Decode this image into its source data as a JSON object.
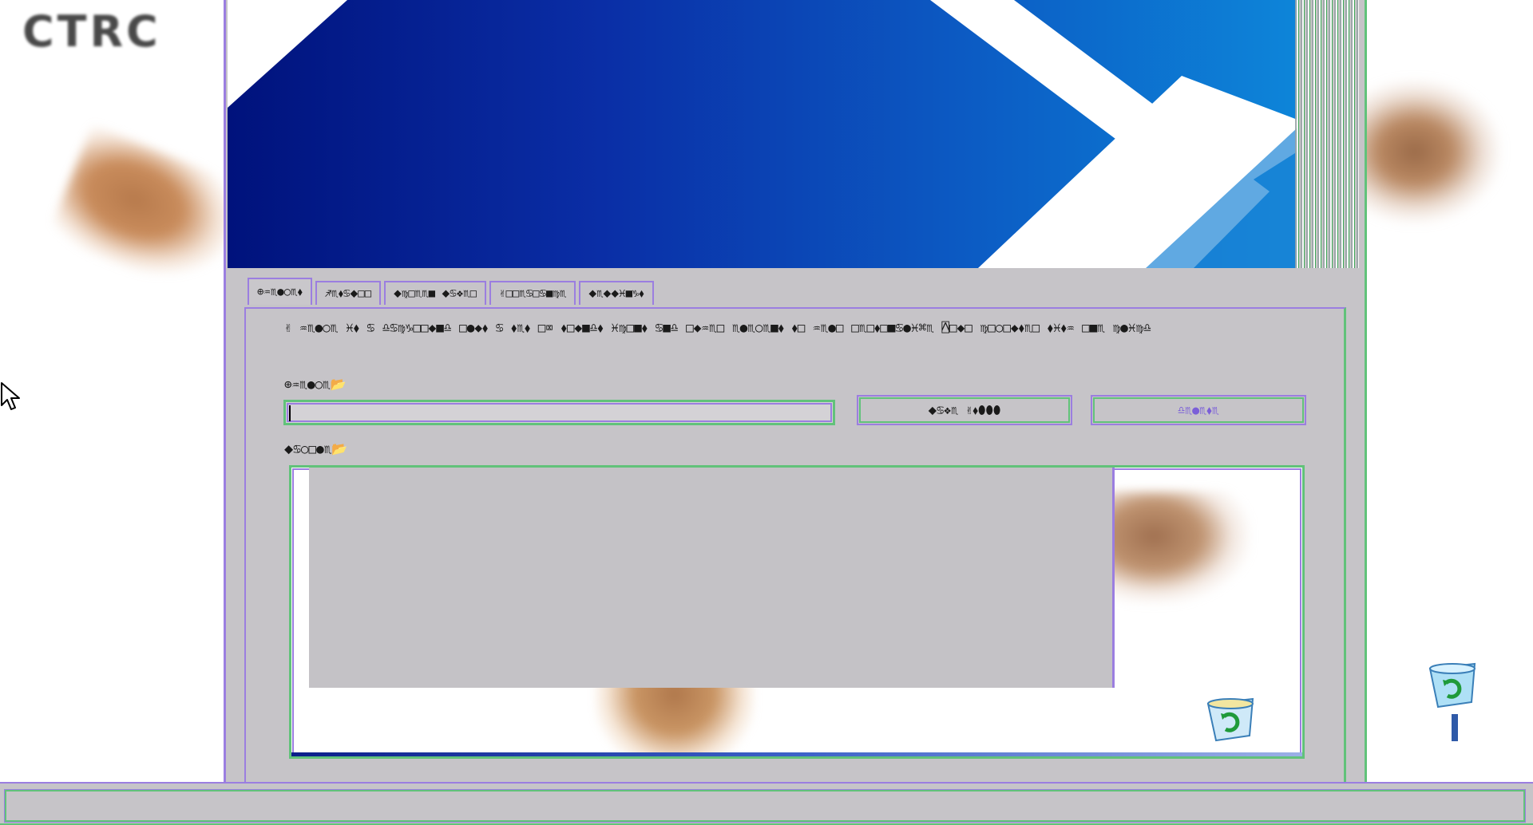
{
  "desktop": {
    "logo_text": "CTRC",
    "cursor_icon": "arrow-cursor-icon",
    "recycle_icon": "recycle-bin-icon"
  },
  "window": {
    "banner_colors": [
      "#00127c",
      "#0d85d9"
    ],
    "tabs": [
      {
        "label": "⊕♒♏●○♏⬧",
        "active": true
      },
      {
        "label": "♐♏⬧♋⬥□□",
        "active": false
      },
      {
        "label": "⬥♍□♏♏■ ⬥♋❖♏□",
        "active": false
      },
      {
        "label": "✌□□♏♋□♋■♍♏",
        "active": false
      },
      {
        "label": "⬥♏⬥⬥♓■♑⬧",
        "active": false
      }
    ],
    "description": "✌ ♒♏●○♏ ♓⬧ ♋ ♎♋♍♑□□◆■♎ □●◆⬧ ♋ ⬧♏⬧ □⌧ ⬧□◆■♎⬧ ♓♍□■⬧ ♋■♎ □◆♒♏□ ♏●♏○♏■⬧ ⬧□ ♒♏●□ □♏□⬧□■♋●♓⌘♏ ⍓□◆□ ♍□○□◆⬧♏□ ⬧♓⬧♒ □■♏ ♍●♓♍♎",
    "url_label": "⊕♒♏●○♏📂",
    "url_value": "",
    "save_button": "⬥♋❖♏ ✌⬧⬮⬮⬮",
    "delete_button": "♎♏●♏⬧♏",
    "preview_label": "⬥♋○□●♏📂",
    "accent_purple": "#9b7ee0",
    "accent_green": "#61c27a"
  },
  "statusbar": {
    "text": ""
  }
}
